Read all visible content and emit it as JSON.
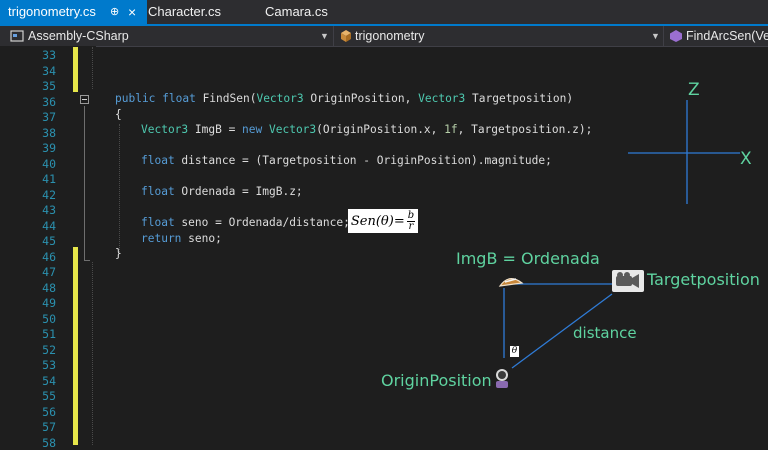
{
  "tabs": [
    {
      "label": "trigonometry.cs",
      "active": true
    },
    {
      "label": "Character.cs",
      "active": false
    },
    {
      "label": "Camara.cs",
      "active": false
    }
  ],
  "tab_controls": {
    "pin": "⊕",
    "close": "×"
  },
  "nav": {
    "project": "Assembly-CSharp",
    "class": "trigonometry",
    "member": "FindArcSen(Vecto"
  },
  "line_numbers": [
    "33",
    "34",
    "35",
    "36",
    "37",
    "38",
    "39",
    "40",
    "41",
    "42",
    "43",
    "44",
    "45",
    "46",
    "47",
    "48",
    "49",
    "50",
    "51",
    "52",
    "53",
    "54",
    "55",
    "56",
    "57",
    "58"
  ],
  "code": {
    "l36_kw": "public float",
    "l36_name": " FindSen(",
    "l36_t1": "Vector3",
    "l36_p1": " OriginPosition, ",
    "l36_t2": "Vector3",
    "l36_p2": " Targetposition)",
    "l37": "{",
    "l38_t": "Vector3",
    "l38_a": " ImgB = ",
    "l38_new": "new",
    "l38_t2": " Vector3",
    "l38_b": "(OriginPosition.x, ",
    "l38_num": "1f",
    "l38_c": ", Targetposition.z);",
    "l40_kw": "float",
    "l40_rest": " distance = (Targetposition - OriginPosition).magnitude;",
    "l42_kw": "float",
    "l42_rest": " Ordenada = ImgB.z;",
    "l44_kw": "float",
    "l44_rest": " seno = Ordenada/distance;",
    "l45_kw": "return",
    "l45_rest": " seno;",
    "l46": "}"
  },
  "formula": {
    "lhs": "Sen(θ)=",
    "num": "b",
    "den": "r"
  },
  "diagram": {
    "axis_z": "Z",
    "axis_x": "X",
    "imgb": "ImgB = Ordenada",
    "target": "Targetposition",
    "distance": "distance",
    "origin": "OriginPosition",
    "theta": "θ"
  },
  "colors": {
    "accent": "#007acc",
    "diagram_label": "#5fd3a0",
    "diagram_line": "#2f7bd6"
  }
}
